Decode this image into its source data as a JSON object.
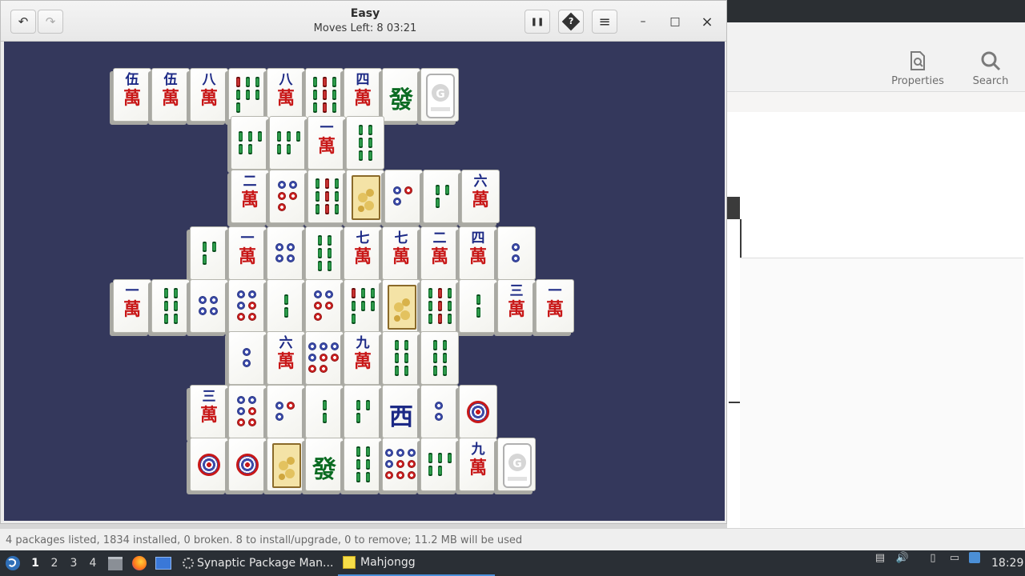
{
  "mahjongg": {
    "title": "Easy",
    "moves_label": "Moves Left:",
    "moves_left": "8",
    "time": "03:21",
    "buttons": {
      "undo": "↶",
      "redo": "↷",
      "pause": "❚❚",
      "hint": "?",
      "menu": "≡",
      "minimize": "–",
      "maximize": "□",
      "close": "×"
    },
    "board_color": "#34385c",
    "tiles": [
      {
        "kind": "char",
        "top": "伍"
      },
      {
        "kind": "char",
        "top": "伍"
      },
      {
        "kind": "char",
        "top": "八"
      },
      {
        "kind": "bam",
        "n": 7
      },
      {
        "kind": "char",
        "top": "八"
      },
      {
        "kind": "bam",
        "n": 9
      },
      {
        "kind": "char",
        "top": "四"
      },
      {
        "kind": "big",
        "glyph": "發",
        "color": "#0b6b22"
      },
      {
        "kind": "season"
      },
      {
        "kind": "bam",
        "n": 5
      },
      {
        "kind": "bam",
        "n": 5
      },
      {
        "kind": "char",
        "top": "一"
      },
      {
        "kind": "bam",
        "n": 6
      },
      {
        "kind": "char",
        "top": "二"
      },
      {
        "kind": "dots",
        "n": 5
      },
      {
        "kind": "bam",
        "n": 9
      },
      {
        "kind": "flower"
      },
      {
        "kind": "dots",
        "n": 3
      },
      {
        "kind": "bam",
        "n": 3
      },
      {
        "kind": "char",
        "top": "六"
      },
      {
        "kind": "bam",
        "n": 3
      },
      {
        "kind": "char",
        "top": "一"
      },
      {
        "kind": "dots",
        "n": 4
      },
      {
        "kind": "bam",
        "n": 6
      },
      {
        "kind": "char",
        "top": "七"
      },
      {
        "kind": "char",
        "top": "七"
      },
      {
        "kind": "char",
        "top": "二"
      },
      {
        "kind": "char",
        "top": "四"
      },
      {
        "kind": "dots",
        "n": 2
      },
      {
        "kind": "char",
        "top": "一"
      },
      {
        "kind": "bam",
        "n": 6
      },
      {
        "kind": "dots",
        "n": 4
      },
      {
        "kind": "dots",
        "n": 6
      },
      {
        "kind": "bam",
        "n": 2
      },
      {
        "kind": "dots",
        "n": 5
      },
      {
        "kind": "bam",
        "n": 7
      },
      {
        "kind": "flower"
      },
      {
        "kind": "bam",
        "n": 9
      },
      {
        "kind": "bam",
        "n": 2
      },
      {
        "kind": "char",
        "top": "三"
      },
      {
        "kind": "char",
        "top": "一"
      },
      {
        "kind": "dots",
        "n": 2
      },
      {
        "kind": "char",
        "top": "六"
      },
      {
        "kind": "dots",
        "n": 8
      },
      {
        "kind": "char",
        "top": "九"
      },
      {
        "kind": "bam",
        "n": 6
      },
      {
        "kind": "bam",
        "n": 6
      },
      {
        "kind": "char",
        "top": "三"
      },
      {
        "kind": "dots",
        "n": 6
      },
      {
        "kind": "dots",
        "n": 3
      },
      {
        "kind": "bam",
        "n": 2
      },
      {
        "kind": "bam",
        "n": 3
      },
      {
        "kind": "big",
        "glyph": "西",
        "color": "#1d2a86"
      },
      {
        "kind": "dots",
        "n": 2
      },
      {
        "kind": "bigdot"
      },
      {
        "kind": "bigdot"
      },
      {
        "kind": "bigdot"
      },
      {
        "kind": "flower"
      },
      {
        "kind": "big",
        "glyph": "發",
        "color": "#0b6b22"
      },
      {
        "kind": "bam",
        "n": 6
      },
      {
        "kind": "dots",
        "n": 9
      },
      {
        "kind": "bam",
        "n": 5
      },
      {
        "kind": "char",
        "top": "九"
      },
      {
        "kind": "season"
      }
    ]
  },
  "synaptic": {
    "toolbar": {
      "properties_label": "Properties",
      "search_label": "Search"
    },
    "status_text": "4 packages listed, 1834 installed, 0 broken. 8 to install/upgrade, 0 to remove; 11.2 MB will be used"
  },
  "taskbar": {
    "workspaces": [
      "1",
      "2",
      "3",
      "4"
    ],
    "active_workspace": "1",
    "tasks": [
      {
        "label": "Synaptic Package Man...",
        "icon": "synaptic-icon"
      },
      {
        "label": "Mahjongg",
        "icon": "mahjongg-icon"
      }
    ],
    "clock": "18:29"
  },
  "tile_glyphs": {
    "wan": "萬",
    "gnome": "G"
  }
}
